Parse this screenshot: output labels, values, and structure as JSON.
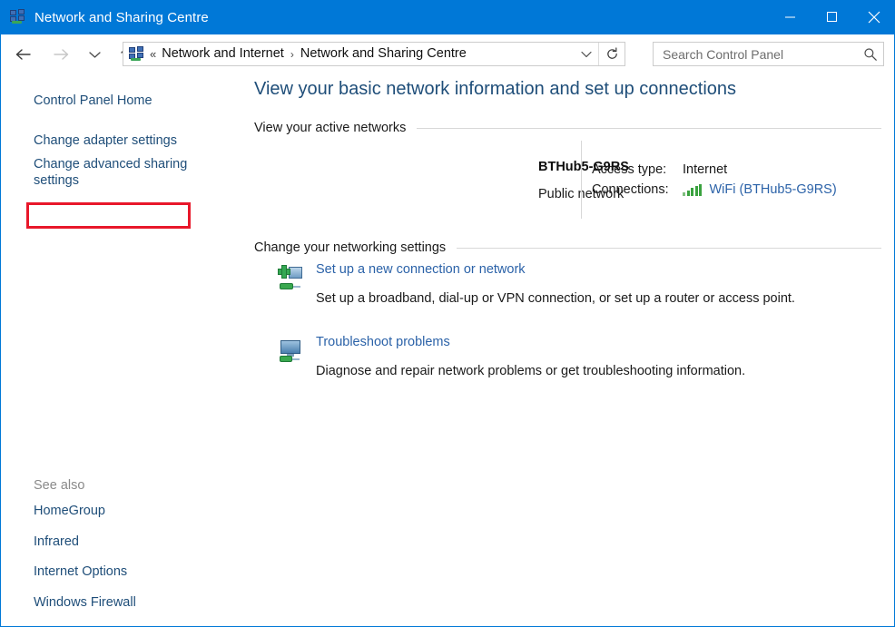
{
  "window": {
    "title": "Network and Sharing Centre",
    "title_icon": "network-icon",
    "titlebar_color": "#0078d7",
    "controls": {
      "minimize": "minimize-button",
      "maximize": "maximize-button",
      "close": "close-button"
    }
  },
  "navigation": {
    "back": "back-arrow-icon",
    "forward": "forward-arrow-icon",
    "history": "chevron-down-icon",
    "up": "up-arrow-icon",
    "address": {
      "icon": "network-icon",
      "overflow": "«",
      "crumbs": [
        "Network and Internet",
        "Network and Sharing Centre"
      ],
      "separator": "›",
      "dropdown": "chevron-down-icon",
      "refresh": "refresh-icon"
    },
    "search": {
      "placeholder": "Search Control Panel",
      "value": "",
      "icon": "search-icon"
    }
  },
  "sidebar": {
    "links": [
      {
        "label": "Control Panel Home",
        "highlighted": false
      },
      {
        "label": "Change adapter settings",
        "highlighted": true
      },
      {
        "label": "Change advanced sharing settings",
        "highlighted": false
      }
    ],
    "highlight_color": "#e8172a",
    "see_also_label": "See also",
    "see_also": [
      "HomeGroup",
      "Infrared",
      "Internet Options",
      "Windows Firewall"
    ]
  },
  "main": {
    "page_title": "View your basic network information and set up connections",
    "active_networks": {
      "heading": "View your active networks",
      "network_name": "BTHub5-G9RS",
      "network_type": "Public network",
      "details": [
        {
          "label": "Access type:",
          "value": "Internet",
          "is_link": false,
          "icon": ""
        },
        {
          "label": "Connections:",
          "value": "WiFi (BTHub5-G9RS)",
          "is_link": true,
          "icon": "wifi-signal-icon"
        }
      ]
    },
    "change_settings": {
      "heading": "Change your networking settings",
      "items": [
        {
          "icon": "setup-connection-icon",
          "title": "Set up a new connection or network",
          "description": "Set up a broadband, dial-up or VPN connection, or set up a router or access point."
        },
        {
          "icon": "troubleshoot-icon",
          "title": "Troubleshoot problems",
          "description": "Diagnose and repair network problems or get troubleshooting information."
        }
      ]
    }
  }
}
